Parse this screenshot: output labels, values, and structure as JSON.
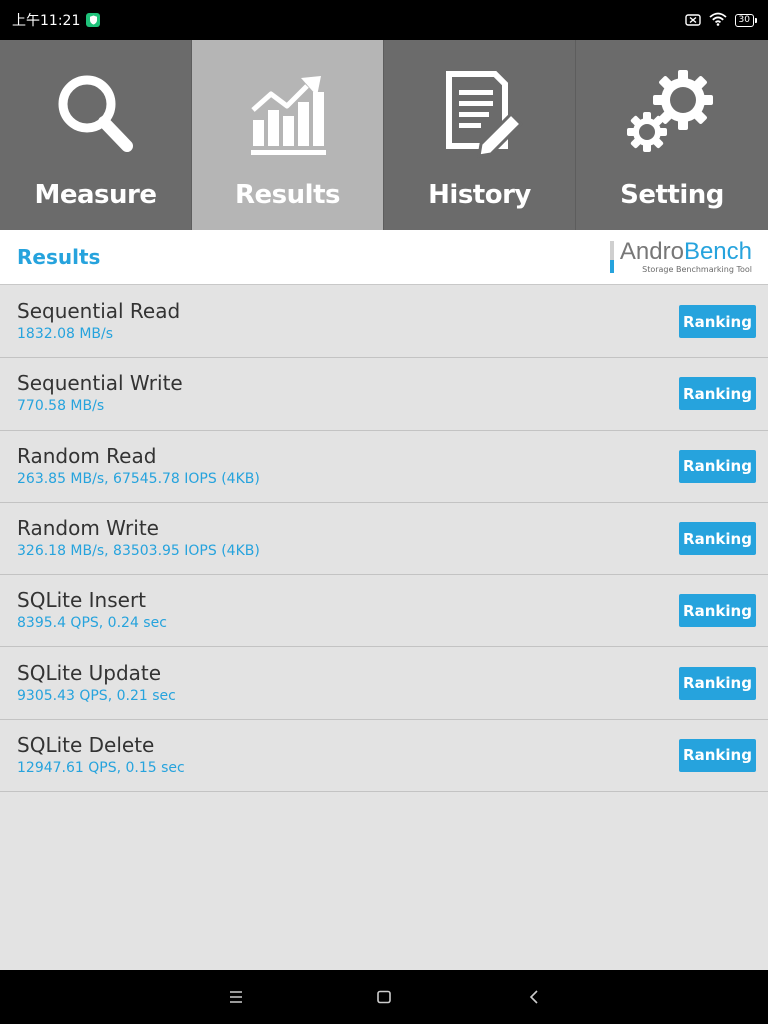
{
  "status_bar": {
    "time": "上午11:21",
    "battery": "30"
  },
  "tabs": [
    {
      "label": "Measure",
      "icon": "magnifier-icon",
      "active": false
    },
    {
      "label": "Results",
      "icon": "chart-icon",
      "active": true
    },
    {
      "label": "History",
      "icon": "document-edit-icon",
      "active": false
    },
    {
      "label": "Setting",
      "icon": "gears-icon",
      "active": false
    }
  ],
  "header": {
    "title": "Results",
    "logo_part1": "Andro",
    "logo_part2": "Bench",
    "logo_subtitle": "Storage Benchmarking Tool"
  },
  "results": [
    {
      "name": "Sequential Read",
      "value": "1832.08 MB/s",
      "button": "Ranking"
    },
    {
      "name": "Sequential Write",
      "value": "770.58 MB/s",
      "button": "Ranking"
    },
    {
      "name": "Random Read",
      "value": "263.85 MB/s, 67545.78 IOPS (4KB)",
      "button": "Ranking"
    },
    {
      "name": "Random Write",
      "value": "326.18 MB/s, 83503.95 IOPS (4KB)",
      "button": "Ranking"
    },
    {
      "name": "SQLite Insert",
      "value": "8395.4 QPS, 0.24 sec",
      "button": "Ranking"
    },
    {
      "name": "SQLite Update",
      "value": "9305.43 QPS, 0.21 sec",
      "button": "Ranking"
    },
    {
      "name": "SQLite Delete",
      "value": "12947.61 QPS, 0.15 sec",
      "button": "Ranking"
    }
  ],
  "colors": {
    "accent": "#26a3dd",
    "tab_bg": "#6b6b6b",
    "tab_active_bg": "#b5b5b5",
    "list_bg": "#e3e3e3"
  }
}
